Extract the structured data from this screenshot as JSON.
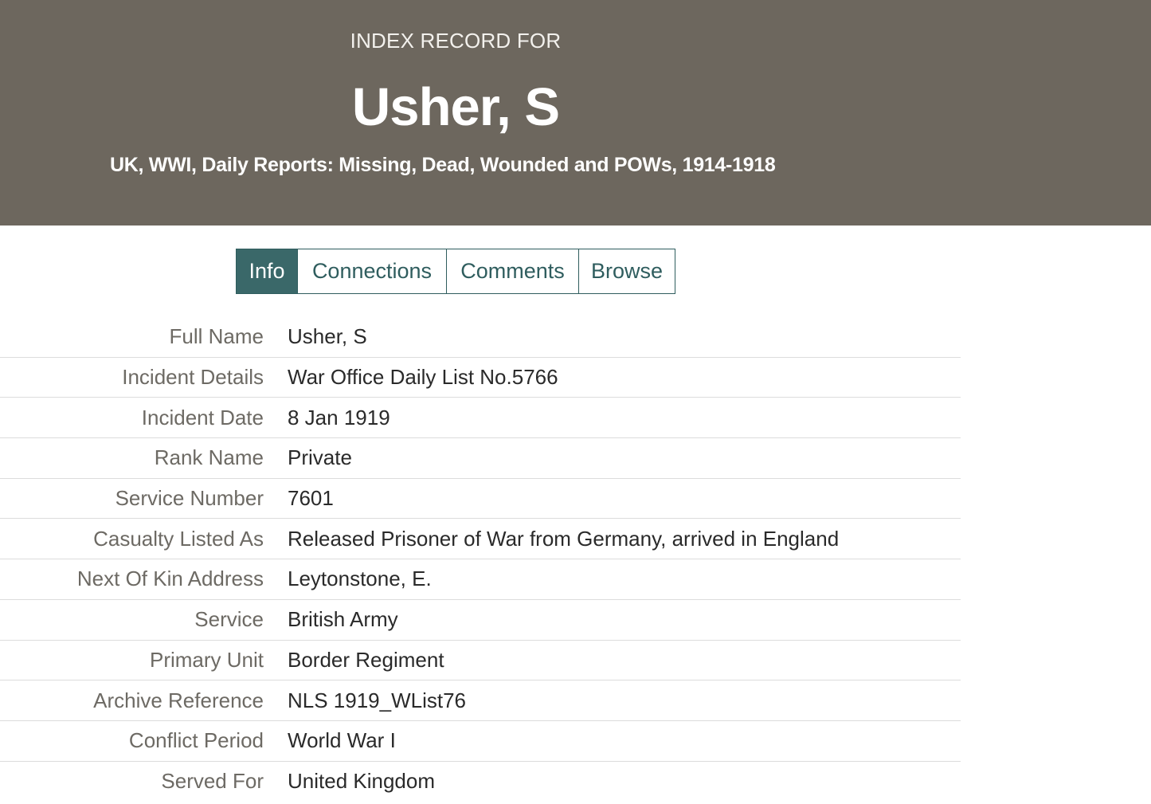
{
  "header": {
    "kicker": "INDEX RECORD FOR",
    "title": "Usher, S",
    "collection": "UK, WWI, Daily Reports: Missing, Dead, Wounded and POWs, 1914-1918",
    "background_color": "#6d675e"
  },
  "tabs": [
    {
      "label": "Info",
      "active": true
    },
    {
      "label": "Connections",
      "active": false
    },
    {
      "label": "Comments",
      "active": false
    },
    {
      "label": "Browse",
      "active": false
    }
  ],
  "accent_color": "#3a6869",
  "records": [
    {
      "label": "Full Name",
      "value": "Usher, S"
    },
    {
      "label": "Incident Details",
      "value": "War Office Daily List No.5766"
    },
    {
      "label": "Incident Date",
      "value": "8 Jan 1919"
    },
    {
      "label": "Rank Name",
      "value": "Private"
    },
    {
      "label": "Service Number",
      "value": "7601"
    },
    {
      "label": "Casualty Listed As",
      "value": "Released Prisoner of War from Germany, arrived in England"
    },
    {
      "label": "Next Of Kin Address",
      "value": "Leytonstone, E."
    },
    {
      "label": "Service",
      "value": "British Army"
    },
    {
      "label": "Primary Unit",
      "value": "Border Regiment"
    },
    {
      "label": "Archive Reference",
      "value": "NLS 1919_WList76"
    },
    {
      "label": "Conflict Period",
      "value": "World War I"
    },
    {
      "label": "Served For",
      "value": "United Kingdom"
    }
  ]
}
